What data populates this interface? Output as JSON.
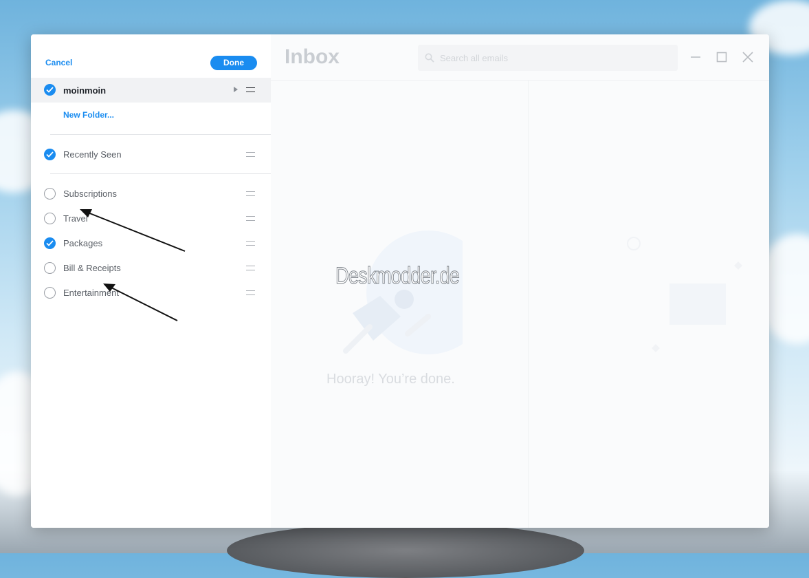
{
  "sidebar": {
    "cancel_label": "Cancel",
    "done_label": "Done",
    "account": {
      "name": "moinmoin",
      "checked": true
    },
    "new_folder_label": "New Folder...",
    "pinned": [
      {
        "label": "Recently Seen",
        "checked": true
      }
    ],
    "folders": [
      {
        "label": "Subscriptions",
        "checked": false
      },
      {
        "label": "Travel",
        "checked": false
      },
      {
        "label": "Packages",
        "checked": true
      },
      {
        "label": "Bill & Receipts",
        "checked": false
      },
      {
        "label": "Entertainment",
        "checked": false
      }
    ]
  },
  "main": {
    "title": "Inbox",
    "search_placeholder": "Search all emails",
    "empty_message": "Hooray! You’re done."
  },
  "watermark": "Deskmodder.de",
  "colors": {
    "accent": "#1a8cf0"
  },
  "icons": [
    "search-icon",
    "minimize-icon",
    "maximize-icon",
    "close-icon",
    "checkmark-icon",
    "drag-handle-icon",
    "expand-caret-icon"
  ]
}
